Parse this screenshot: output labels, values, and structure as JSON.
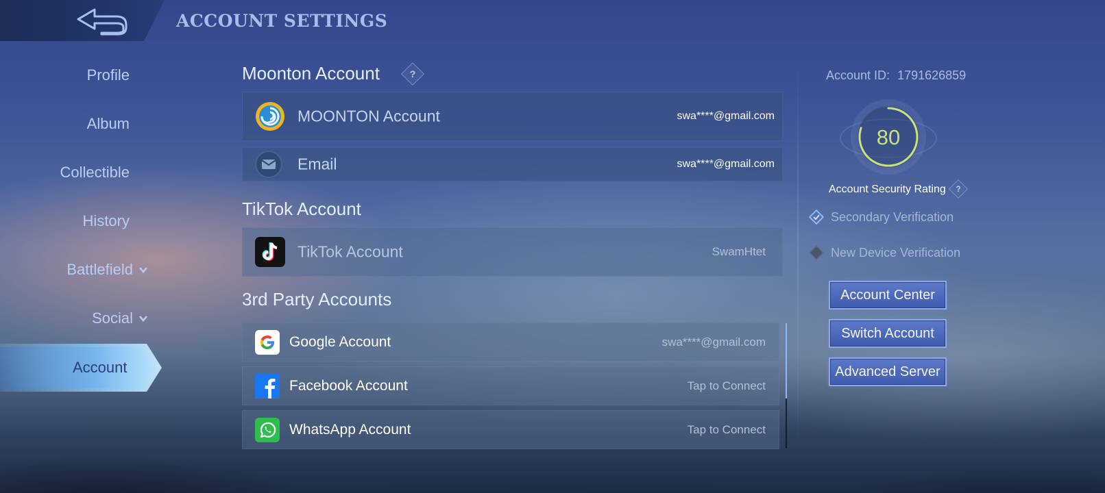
{
  "header": {
    "title": "ACCOUNT SETTINGS",
    "back_icon": "back-arrow-icon"
  },
  "sidebar": {
    "items": [
      {
        "label": "Profile",
        "expandable": false
      },
      {
        "label": "Album",
        "expandable": false
      },
      {
        "label": "Collectible",
        "expandable": false
      },
      {
        "label": "History",
        "expandable": false
      },
      {
        "label": "Battlefield",
        "expandable": true
      },
      {
        "label": "Social",
        "expandable": true
      },
      {
        "label": "Account",
        "expandable": false,
        "active": true
      }
    ]
  },
  "main": {
    "moonton": {
      "title": "Moonton Account",
      "help": "?",
      "rows": [
        {
          "label": "MOONTON Account",
          "value": "swa****@gmail.com",
          "icon": "moonton-logo-icon"
        },
        {
          "label": "Email",
          "value": "swa****@gmail.com",
          "icon": "mail-icon"
        }
      ]
    },
    "tiktok": {
      "title": "TikTok Account",
      "rows": [
        {
          "label": "TikTok Account",
          "value": "SwamHtet",
          "icon": "tiktok-icon"
        }
      ]
    },
    "third_party": {
      "title": "3rd Party Accounts",
      "rows": [
        {
          "label": "Google Account",
          "value": "swa****@gmail.com",
          "icon": "google-icon"
        },
        {
          "label": "Facebook Account",
          "value": "Tap to Connect",
          "icon": "facebook-icon"
        },
        {
          "label": "WhatsApp Account",
          "value": "Tap to Connect",
          "icon": "whatsapp-icon"
        }
      ]
    }
  },
  "right_panel": {
    "account_id_label": "Account ID:",
    "account_id": "1791626859",
    "security_rating": "80",
    "security_fraction": 0.8,
    "security_label": "Account Security Rating",
    "help": "?",
    "verifications": [
      {
        "label": "Secondary Verification",
        "enabled": true
      },
      {
        "label": "New Device Verification",
        "enabled": false
      }
    ],
    "buttons": {
      "account_center": "Account Center",
      "switch_account": "Switch Account",
      "advanced_server": "Advanced Server"
    }
  },
  "colors": {
    "accent": "#8fb8ff",
    "rating_green": "#c9e27a",
    "button_bg": "#4a68bd"
  }
}
